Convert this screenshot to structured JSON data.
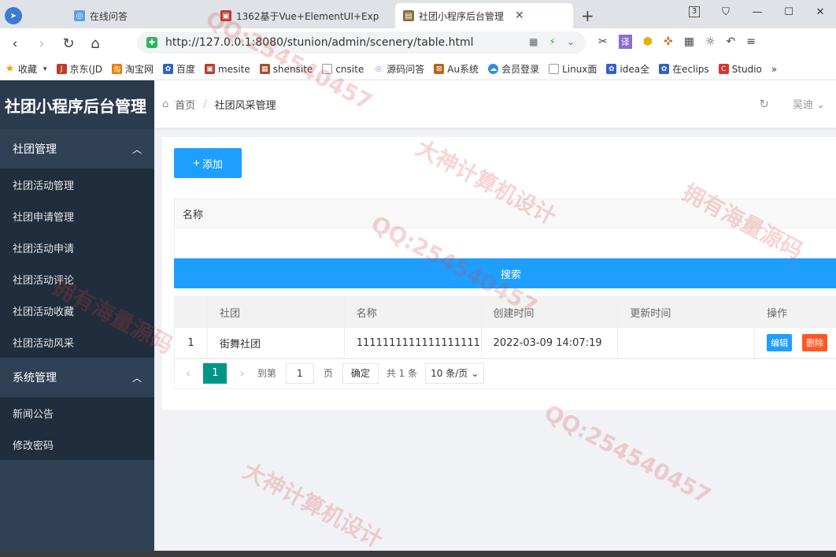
{
  "browser": {
    "tabs": [
      {
        "label": "在线问答",
        "active": false
      },
      {
        "label": "1362基于Vue+ElementUI+Exp",
        "active": false
      },
      {
        "label": "社团小程序后台管理",
        "active": true
      }
    ],
    "url": "http://127.0.0.1:8080/stunion/admin/scenery/table.html",
    "tab_count": "3",
    "bookmarks": [
      "收藏",
      "京东(JD",
      "淘宝网",
      "百度",
      "mesite",
      "shensite",
      "cnsite",
      "源码问答",
      "Au系统",
      "会员登录",
      "Linux面",
      "idea全",
      "在eclips",
      "Studio"
    ]
  },
  "sidebar": {
    "title": "社团小程序后台管理",
    "groups": [
      {
        "label": "社团管理",
        "items": [
          "社团活动管理",
          "社团申请管理",
          "社团活动申请",
          "社团活动评论",
          "社团活动收藏",
          "社团活动风采"
        ]
      },
      {
        "label": "系统管理",
        "items": [
          "新闻公告",
          "修改密码"
        ]
      }
    ]
  },
  "header": {
    "breadcrumb_home": "首页",
    "breadcrumb_sep": "/",
    "breadcrumb_current": "社团风采管理",
    "user": "吴迪"
  },
  "toolbar": {
    "add_label": "添加",
    "filter_label": "名称",
    "search_label": "搜索"
  },
  "table": {
    "columns": [
      "",
      "社团",
      "名称",
      "创建时间",
      "更新时间",
      "操作"
    ],
    "rows": [
      {
        "index": "1",
        "club": "街舞社团",
        "name": "1111111111111111111",
        "created": "2022-03-09 14:07:19",
        "updated": "",
        "edit": "编辑",
        "delete": "删除"
      }
    ]
  },
  "pager": {
    "current": "1",
    "goto_prefix": "到第",
    "goto_value": "1",
    "goto_suffix": "页",
    "confirm": "确定",
    "total": "共 1 条",
    "page_size": "10 条/页"
  },
  "watermark": [
    "QQ:254540457",
    "大神计算机设计",
    "拥有海量源码"
  ]
}
